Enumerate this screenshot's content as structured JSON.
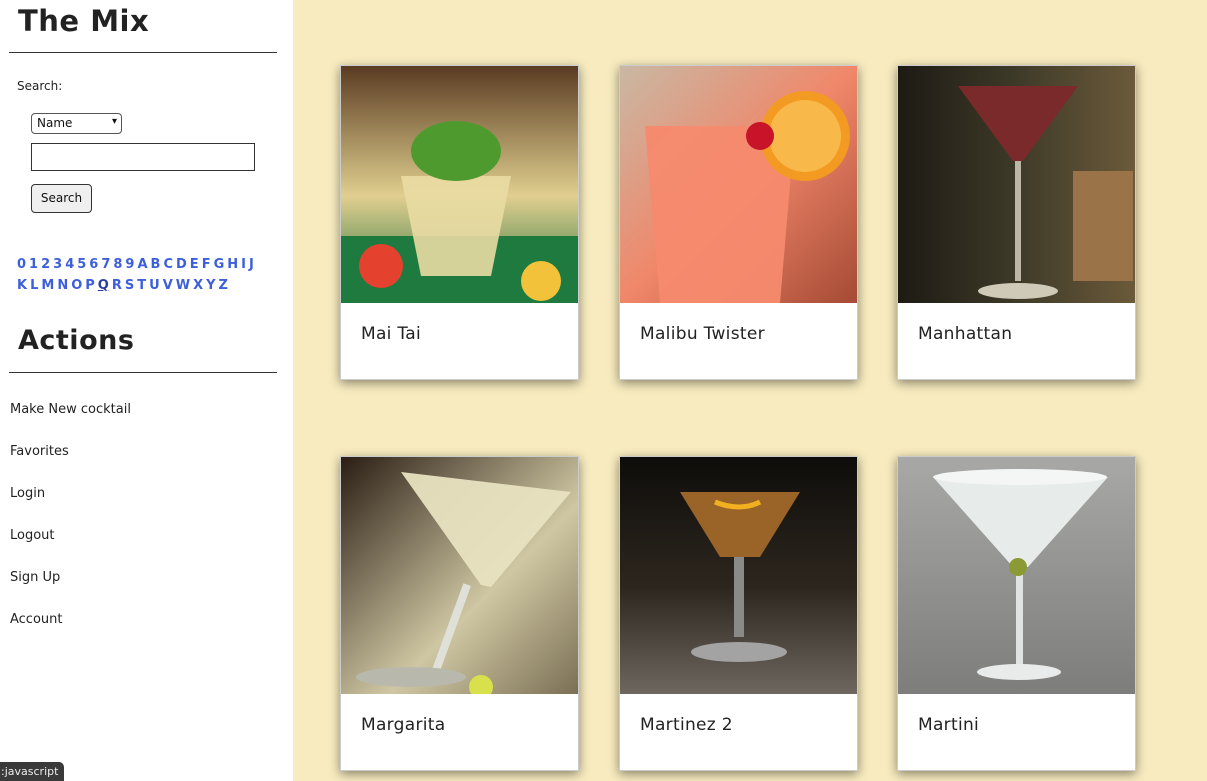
{
  "sidebar": {
    "brand": "The Mix",
    "search_label": "Search:",
    "search_type": "Name",
    "search_value": "",
    "search_button": "Search",
    "letters": [
      "0",
      "1",
      "2",
      "3",
      "4",
      "5",
      "6",
      "7",
      "8",
      "9",
      "A",
      "B",
      "C",
      "D",
      "E",
      "F",
      "G",
      "H",
      "I",
      "J",
      "K",
      "L",
      "M",
      "N",
      "O",
      "P",
      "Q",
      "R",
      "S",
      "T",
      "U",
      "V",
      "W",
      "X",
      "Y",
      "Z"
    ],
    "active_letter": "Q",
    "actions_title": "Actions",
    "actions": [
      "Make New cocktail",
      "Favorites",
      "Login",
      "Logout",
      "Sign Up",
      "Account"
    ]
  },
  "cards": [
    {
      "name": "Mai Tai",
      "image_icon": "cocktail-photo"
    },
    {
      "name": "Malibu Twister",
      "image_icon": "cocktail-photo"
    },
    {
      "name": "Manhattan",
      "image_icon": "cocktail-photo"
    },
    {
      "name": "Margarita",
      "image_icon": "cocktail-photo"
    },
    {
      "name": "Martinez 2",
      "image_icon": "cocktail-photo"
    },
    {
      "name": "Martini",
      "image_icon": "cocktail-photo"
    }
  ],
  "status_bar": "javascript:",
  "colors": {
    "background": "#f7ebbf",
    "link": "#3d5fd9"
  }
}
